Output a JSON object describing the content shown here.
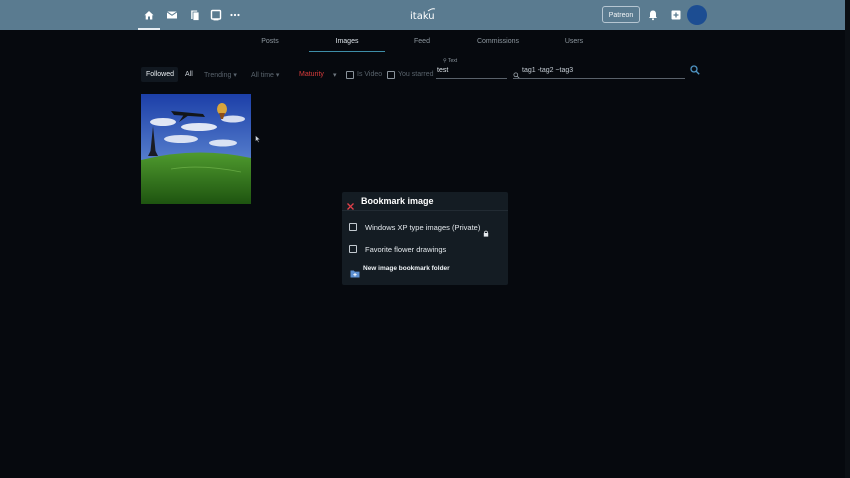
{
  "topbar": {
    "logo_text": "itaku",
    "patreon_label": "Patreon",
    "icons": [
      "home-icon",
      "mail-icon",
      "bookmarks-icon",
      "tablet-icon",
      "more-icon",
      "bell-icon",
      "add-box-icon"
    ]
  },
  "tabs": [
    {
      "label": "Posts"
    },
    {
      "label": "Images"
    },
    {
      "label": "Feed"
    },
    {
      "label": "Commissions"
    },
    {
      "label": "Users"
    }
  ],
  "filters": {
    "followed": "Followed",
    "all": "All",
    "trending": "Trending",
    "all_time": "All time",
    "maturity": "Maturity",
    "is_video": "Is Video",
    "you_starred": "You starred",
    "text_label": "Text",
    "text_value": "test",
    "tags_value": "tag1 -tag2 ~tag3"
  },
  "dialog": {
    "title": "Bookmark image",
    "folders": [
      {
        "label": "Windows XP type images (Private)",
        "checked": false,
        "private": true
      },
      {
        "label": "Favorite flower drawings",
        "checked": false,
        "private": false
      }
    ],
    "new_folder_label": "New image bookmark folder"
  },
  "colors": {
    "topbar": "#5a7b90",
    "background": "#06090e",
    "accent": "#3e8ea8",
    "maturity": "#d83b3b",
    "close": "#e0404a",
    "avatar": "#1c4d92"
  }
}
